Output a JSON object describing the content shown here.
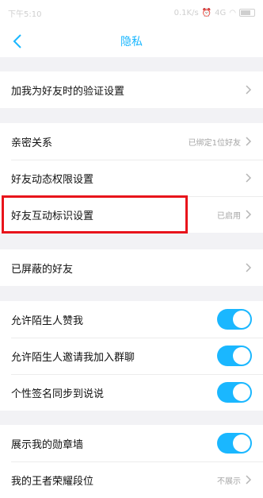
{
  "status_bar": {
    "time": "下午5:10",
    "network_speed": "0.1K/s",
    "network_type": "4G",
    "icons": [
      "bluetooth-icon",
      "alarm-icon",
      "signal-icon",
      "wifi-icon",
      "battery-icon"
    ]
  },
  "header": {
    "title": "隐私",
    "back_icon": "chevron-left-icon"
  },
  "rows": {
    "verify": {
      "label": "加我为好友时的验证设置"
    },
    "intimate": {
      "label": "亲密关系",
      "value": "已绑定1位好友"
    },
    "moments": {
      "label": "好友动态权限设置"
    },
    "interaction": {
      "label": "好友互动标识设置",
      "value": "已启用"
    },
    "blocked": {
      "label": "已屏蔽的好友"
    },
    "like": {
      "label": "允许陌生人赞我",
      "on": true
    },
    "invite": {
      "label": "允许陌生人邀请我加入群聊",
      "on": true
    },
    "signature": {
      "label": "个性签名同步到说说",
      "on": true
    },
    "medal": {
      "label": "展示我的勋章墙",
      "on": true
    },
    "honor": {
      "label": "我的王者荣耀段位",
      "value": "不展示"
    }
  },
  "colors": {
    "accent": "#1ab7ff",
    "highlight": "#e8141b",
    "background": "#f2f2f5"
  }
}
